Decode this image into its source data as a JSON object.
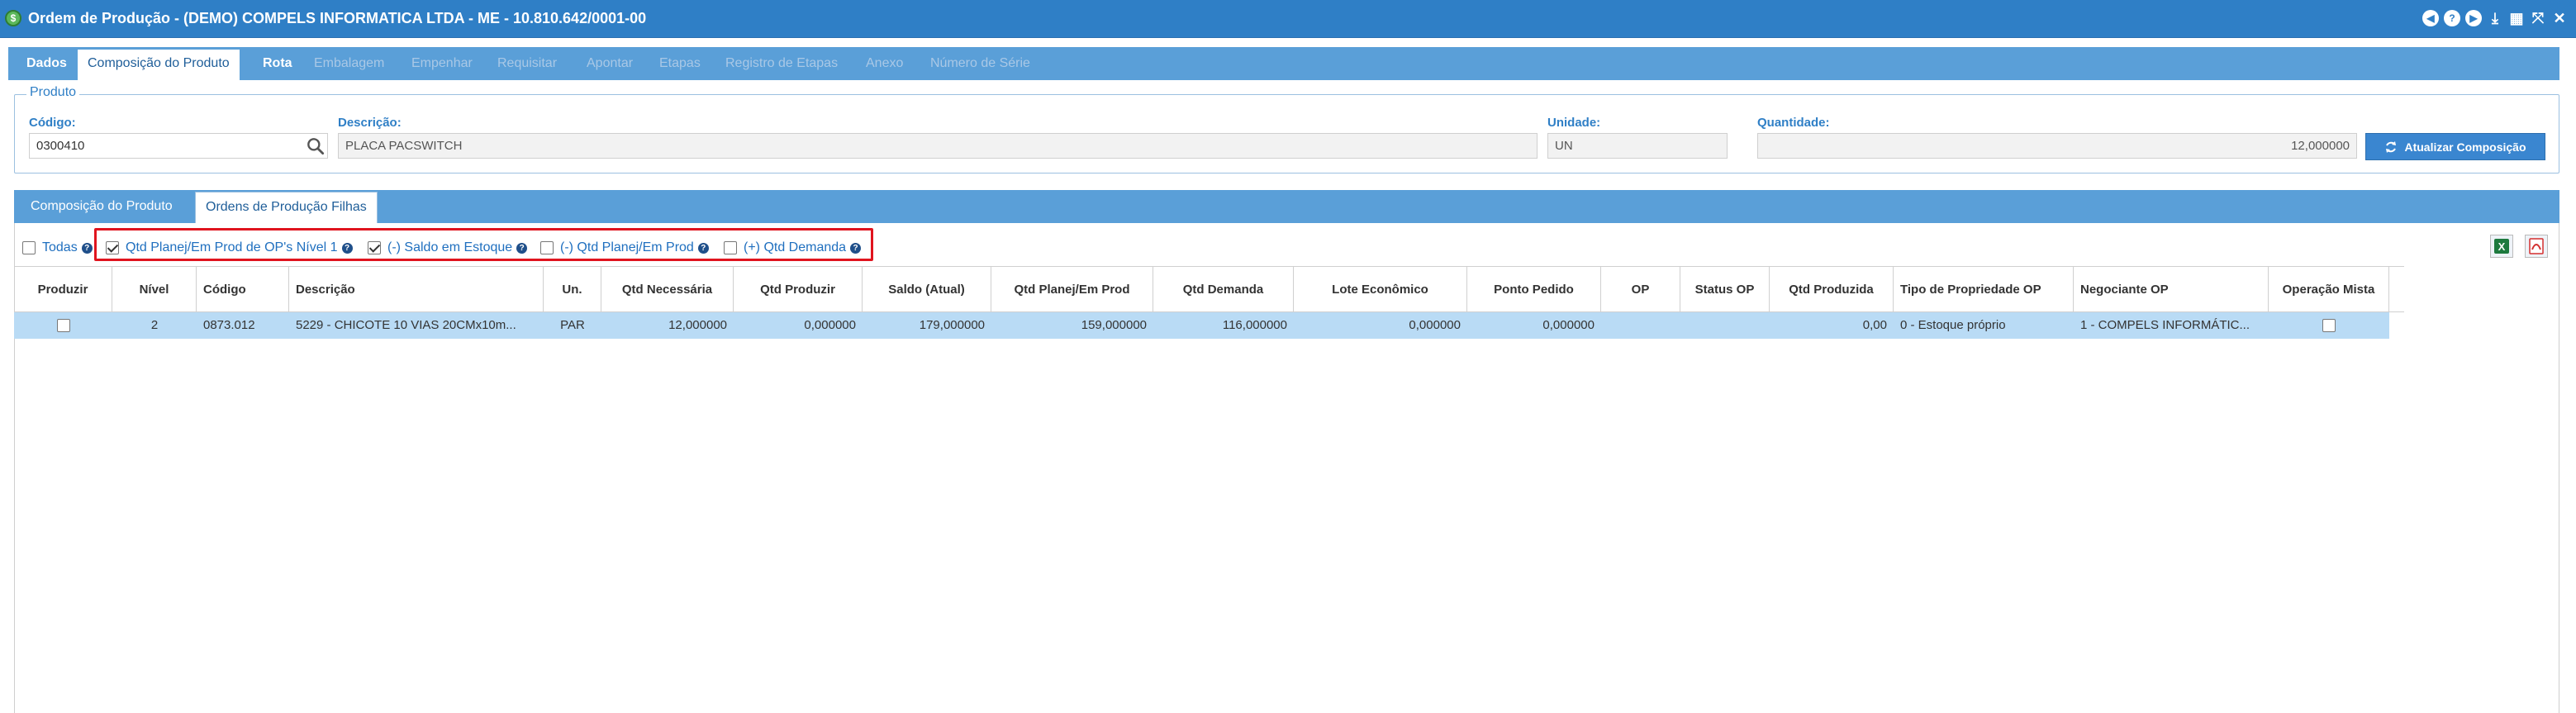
{
  "window": {
    "title": "Ordem de Produção - (DEMO) COMPELS INFORMATICA LTDA - ME - 10.810.642/0001-00",
    "controls": [
      "back-icon",
      "help-icon",
      "forward-icon",
      "download-icon",
      "calendar-icon",
      "resize-icon",
      "close-icon"
    ]
  },
  "main_tabs": [
    {
      "label": "Dados",
      "state": "normal"
    },
    {
      "label": "Composição do Produto",
      "state": "active"
    },
    {
      "label": "Rota",
      "state": "normal"
    },
    {
      "label": "Embalagem",
      "state": "disabled"
    },
    {
      "label": "Empenhar",
      "state": "disabled"
    },
    {
      "label": "Requisitar",
      "state": "disabled"
    },
    {
      "label": "Apontar",
      "state": "disabled"
    },
    {
      "label": "Etapas",
      "state": "disabled"
    },
    {
      "label": "Registro de Etapas",
      "state": "disabled"
    },
    {
      "label": "Anexo",
      "state": "disabled"
    },
    {
      "label": "Número de Série",
      "state": "disabled"
    }
  ],
  "produto": {
    "legend": "Produto",
    "codigo_label": "Código:",
    "codigo_value": "0300410",
    "descricao_label": "Descrição:",
    "descricao_value": "PLACA PACSWITCH",
    "unidade_label": "Unidade:",
    "unidade_value": "UN",
    "quantidade_label": "Quantidade:",
    "quantidade_value": "12,000000",
    "atualizar_label": "Atualizar Composição"
  },
  "sub_tabs": [
    {
      "label": "Composição do Produto",
      "state": "normal"
    },
    {
      "label": "Ordens de Produção Filhas",
      "state": "active"
    }
  ],
  "filters": {
    "todas": {
      "label": "Todas",
      "checked": false
    },
    "qtd_planej_nivel1": {
      "label": "Qtd Planej/Em Prod de OP's Nível 1",
      "checked": true
    },
    "saldo_estoque": {
      "label": "(-) Saldo em Estoque",
      "checked": true
    },
    "qtd_planej_prod": {
      "label": "(-) Qtd Planej/Em Prod",
      "checked": false
    },
    "qtd_demanda": {
      "label": "(+) Qtd Demanda",
      "checked": false
    }
  },
  "colors": {
    "title_bar": "#2f7fc6",
    "tab_bar": "#5a9fd8",
    "label_blue": "#2f7fc6",
    "selected_row": "#b9dbf5",
    "highlight_box": "#e0141e"
  },
  "table": {
    "headers": {
      "produzir": "Produzir",
      "nivel": "Nível",
      "codigo": "Código",
      "descricao": "Descrição",
      "un": "Un.",
      "qtd_necessaria": "Qtd Necessária",
      "qtd_produzir": "Qtd Produzir",
      "saldo_atual": "Saldo (Atual)",
      "qtd_planej": "Qtd Planej/Em Prod",
      "qtd_demanda": "Qtd Demanda",
      "lote_economico": "Lote Econômico",
      "ponto_pedido": "Ponto Pedido",
      "op": "OP",
      "status_op": "Status OP",
      "qtd_produzida": "Qtd Produzida",
      "tipo_propriedade": "Tipo de Propriedade OP",
      "negociante": "Negociante OP",
      "operacao_mista": "Operação Mista"
    },
    "rows": [
      {
        "produzir": false,
        "nivel": "2",
        "codigo": "0873.012",
        "descricao": "5229 - CHICOTE 10 VIAS 20CMx10m...",
        "un": "PAR",
        "qtd_necessaria": "12,000000",
        "qtd_produzir": "0,000000",
        "saldo_atual": "179,000000",
        "qtd_planej": "159,000000",
        "qtd_demanda": "116,000000",
        "lote_economico": "0,000000",
        "ponto_pedido": "0,000000",
        "op": "",
        "status_op": "",
        "qtd_produzida": "0,00",
        "tipo_propriedade": "0 - Estoque próprio",
        "negociante": "1 - COMPELS INFORMÁTIC...",
        "operacao_mista": false
      }
    ]
  }
}
